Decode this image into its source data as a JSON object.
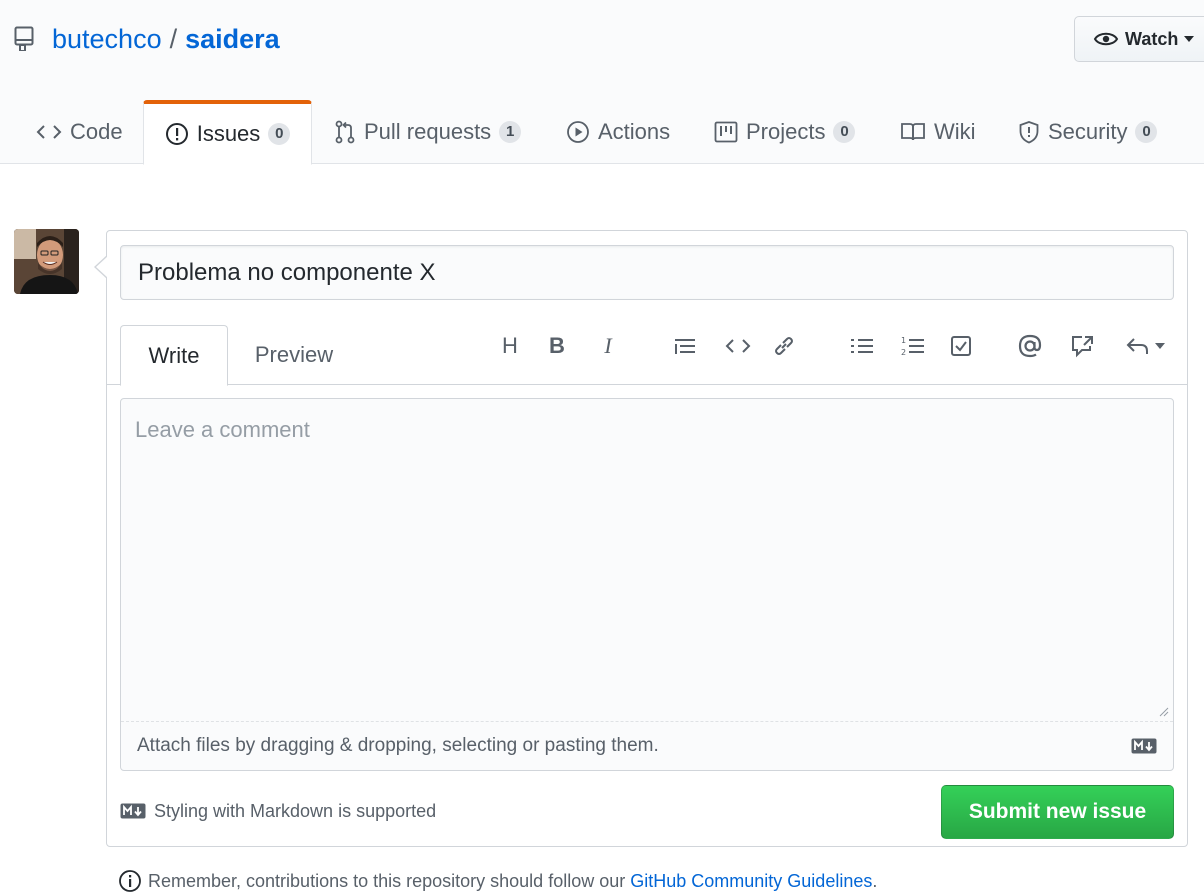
{
  "repo": {
    "owner": "butechco",
    "separator": "/",
    "name": "saidera"
  },
  "watch": {
    "label": "Watch"
  },
  "nav_tabs": [
    {
      "label": "Code",
      "icon": "code-icon"
    },
    {
      "label": "Issues",
      "icon": "issue-opened-icon",
      "count": "0"
    },
    {
      "label": "Pull requests",
      "icon": "git-pull-request-icon",
      "count": "1"
    },
    {
      "label": "Actions",
      "icon": "play-icon"
    },
    {
      "label": "Projects",
      "icon": "project-icon",
      "count": "0"
    },
    {
      "label": "Wiki",
      "icon": "book-icon"
    },
    {
      "label": "Security",
      "icon": "shield-icon",
      "count": "0"
    }
  ],
  "form": {
    "title_value": "Problema no componente X",
    "write_label": "Write",
    "preview_label": "Preview",
    "toolbar": {
      "heading": "H",
      "bold": "B",
      "italic": "I"
    },
    "comment_placeholder": "Leave a comment",
    "attach_text": "Attach files by dragging & dropping, selecting or pasting them.",
    "markdown_note": "Styling with Markdown is supported",
    "submit_label": "Submit new issue"
  },
  "guidelines": {
    "prefix": "Remember, contributions to this repository should follow our",
    "link": "GitHub Community Guidelines",
    "suffix": "."
  },
  "colors": {
    "link": "#0366d6",
    "selected_tab_accent": "#e36209",
    "submit_green": "#28a745"
  }
}
